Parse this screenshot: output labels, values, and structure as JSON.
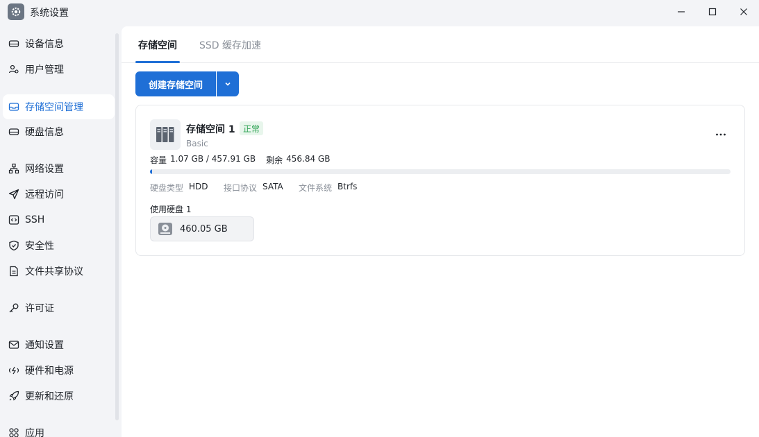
{
  "window": {
    "title": "系统设置"
  },
  "sidebar": {
    "items": [
      {
        "label": "设备信息",
        "icon": "device-icon",
        "active": false
      },
      {
        "label": "用户管理",
        "icon": "users-icon",
        "active": false
      },
      {
        "label": "存储空间管理",
        "icon": "storage-icon",
        "active": true
      },
      {
        "label": "硬盘信息",
        "icon": "disk-icon",
        "active": false
      },
      {
        "label": "网络设置",
        "icon": "network-icon",
        "active": false
      },
      {
        "label": "远程访问",
        "icon": "send-icon",
        "active": false
      },
      {
        "label": "SSH",
        "icon": "code-icon",
        "active": false
      },
      {
        "label": "安全性",
        "icon": "shield-icon",
        "active": false
      },
      {
        "label": "文件共享协议",
        "icon": "file-icon",
        "active": false
      },
      {
        "label": "许可证",
        "icon": "key-icon",
        "active": false
      },
      {
        "label": "通知设置",
        "icon": "mail-icon",
        "active": false
      },
      {
        "label": "硬件和电源",
        "icon": "power-icon",
        "active": false
      },
      {
        "label": "更新和还原",
        "icon": "rocket-icon",
        "active": false
      },
      {
        "label": "应用",
        "icon": "apps-icon",
        "active": false
      }
    ]
  },
  "tabs": [
    {
      "label": "存储空间",
      "active": true
    },
    {
      "label": "SSD 缓存加速",
      "active": false
    }
  ],
  "toolbar": {
    "create_label": "创建存储空间"
  },
  "pool": {
    "name": "存储空间 1",
    "status": "正常",
    "type": "Basic",
    "capacity_label": "容量",
    "capacity_value": "1.07 GB / 457.91 GB",
    "remaining_label": "剩余",
    "remaining_value": "456.84 GB",
    "usage_percent": 0.23,
    "disk_type_label": "硬盘类型",
    "disk_type": "HDD",
    "interface_label": "接口协议",
    "interface": "SATA",
    "fs_label": "文件系统",
    "fs": "Btrfs",
    "used_disks_label": "使用硬盘 1",
    "disk_size": "460.05 GB"
  },
  "colors": {
    "accent": "#1f6fd6",
    "status_ok": "#2ea353"
  }
}
